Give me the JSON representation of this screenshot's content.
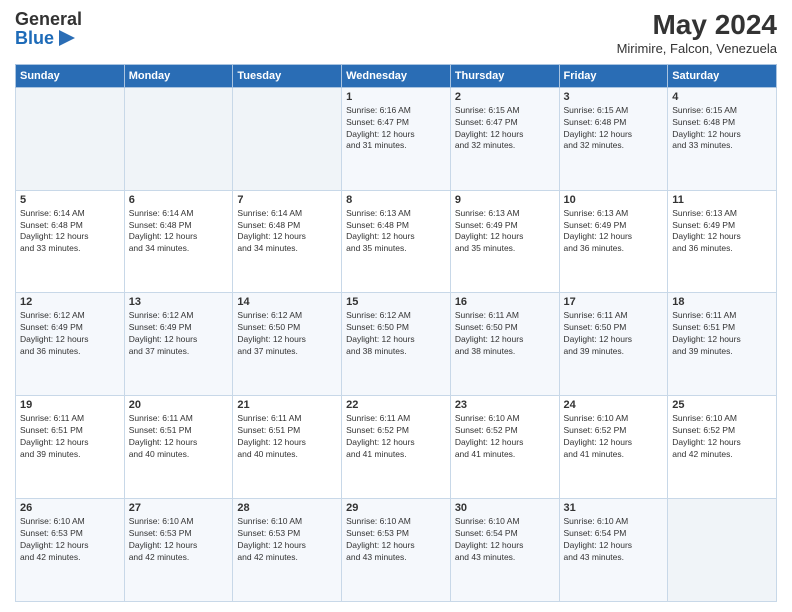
{
  "logo": {
    "text_general": "General",
    "text_blue": "Blue",
    "icon_unicode": "▶"
  },
  "title": {
    "month_year": "May 2024",
    "location": "Mirimire, Falcon, Venezuela"
  },
  "weekdays": [
    "Sunday",
    "Monday",
    "Tuesday",
    "Wednesday",
    "Thursday",
    "Friday",
    "Saturday"
  ],
  "weeks": [
    [
      {
        "day": "",
        "info": ""
      },
      {
        "day": "",
        "info": ""
      },
      {
        "day": "",
        "info": ""
      },
      {
        "day": "1",
        "info": "Sunrise: 6:16 AM\nSunset: 6:47 PM\nDaylight: 12 hours\nand 31 minutes."
      },
      {
        "day": "2",
        "info": "Sunrise: 6:15 AM\nSunset: 6:47 PM\nDaylight: 12 hours\nand 32 minutes."
      },
      {
        "day": "3",
        "info": "Sunrise: 6:15 AM\nSunset: 6:48 PM\nDaylight: 12 hours\nand 32 minutes."
      },
      {
        "day": "4",
        "info": "Sunrise: 6:15 AM\nSunset: 6:48 PM\nDaylight: 12 hours\nand 33 minutes."
      }
    ],
    [
      {
        "day": "5",
        "info": "Sunrise: 6:14 AM\nSunset: 6:48 PM\nDaylight: 12 hours\nand 33 minutes."
      },
      {
        "day": "6",
        "info": "Sunrise: 6:14 AM\nSunset: 6:48 PM\nDaylight: 12 hours\nand 34 minutes."
      },
      {
        "day": "7",
        "info": "Sunrise: 6:14 AM\nSunset: 6:48 PM\nDaylight: 12 hours\nand 34 minutes."
      },
      {
        "day": "8",
        "info": "Sunrise: 6:13 AM\nSunset: 6:48 PM\nDaylight: 12 hours\nand 35 minutes."
      },
      {
        "day": "9",
        "info": "Sunrise: 6:13 AM\nSunset: 6:49 PM\nDaylight: 12 hours\nand 35 minutes."
      },
      {
        "day": "10",
        "info": "Sunrise: 6:13 AM\nSunset: 6:49 PM\nDaylight: 12 hours\nand 36 minutes."
      },
      {
        "day": "11",
        "info": "Sunrise: 6:13 AM\nSunset: 6:49 PM\nDaylight: 12 hours\nand 36 minutes."
      }
    ],
    [
      {
        "day": "12",
        "info": "Sunrise: 6:12 AM\nSunset: 6:49 PM\nDaylight: 12 hours\nand 36 minutes."
      },
      {
        "day": "13",
        "info": "Sunrise: 6:12 AM\nSunset: 6:49 PM\nDaylight: 12 hours\nand 37 minutes."
      },
      {
        "day": "14",
        "info": "Sunrise: 6:12 AM\nSunset: 6:50 PM\nDaylight: 12 hours\nand 37 minutes."
      },
      {
        "day": "15",
        "info": "Sunrise: 6:12 AM\nSunset: 6:50 PM\nDaylight: 12 hours\nand 38 minutes."
      },
      {
        "day": "16",
        "info": "Sunrise: 6:11 AM\nSunset: 6:50 PM\nDaylight: 12 hours\nand 38 minutes."
      },
      {
        "day": "17",
        "info": "Sunrise: 6:11 AM\nSunset: 6:50 PM\nDaylight: 12 hours\nand 39 minutes."
      },
      {
        "day": "18",
        "info": "Sunrise: 6:11 AM\nSunset: 6:51 PM\nDaylight: 12 hours\nand 39 minutes."
      }
    ],
    [
      {
        "day": "19",
        "info": "Sunrise: 6:11 AM\nSunset: 6:51 PM\nDaylight: 12 hours\nand 39 minutes."
      },
      {
        "day": "20",
        "info": "Sunrise: 6:11 AM\nSunset: 6:51 PM\nDaylight: 12 hours\nand 40 minutes."
      },
      {
        "day": "21",
        "info": "Sunrise: 6:11 AM\nSunset: 6:51 PM\nDaylight: 12 hours\nand 40 minutes."
      },
      {
        "day": "22",
        "info": "Sunrise: 6:11 AM\nSunset: 6:52 PM\nDaylight: 12 hours\nand 41 minutes."
      },
      {
        "day": "23",
        "info": "Sunrise: 6:10 AM\nSunset: 6:52 PM\nDaylight: 12 hours\nand 41 minutes."
      },
      {
        "day": "24",
        "info": "Sunrise: 6:10 AM\nSunset: 6:52 PM\nDaylight: 12 hours\nand 41 minutes."
      },
      {
        "day": "25",
        "info": "Sunrise: 6:10 AM\nSunset: 6:52 PM\nDaylight: 12 hours\nand 42 minutes."
      }
    ],
    [
      {
        "day": "26",
        "info": "Sunrise: 6:10 AM\nSunset: 6:53 PM\nDaylight: 12 hours\nand 42 minutes."
      },
      {
        "day": "27",
        "info": "Sunrise: 6:10 AM\nSunset: 6:53 PM\nDaylight: 12 hours\nand 42 minutes."
      },
      {
        "day": "28",
        "info": "Sunrise: 6:10 AM\nSunset: 6:53 PM\nDaylight: 12 hours\nand 42 minutes."
      },
      {
        "day": "29",
        "info": "Sunrise: 6:10 AM\nSunset: 6:53 PM\nDaylight: 12 hours\nand 43 minutes."
      },
      {
        "day": "30",
        "info": "Sunrise: 6:10 AM\nSunset: 6:54 PM\nDaylight: 12 hours\nand 43 minutes."
      },
      {
        "day": "31",
        "info": "Sunrise: 6:10 AM\nSunset: 6:54 PM\nDaylight: 12 hours\nand 43 minutes."
      },
      {
        "day": "",
        "info": ""
      }
    ]
  ]
}
